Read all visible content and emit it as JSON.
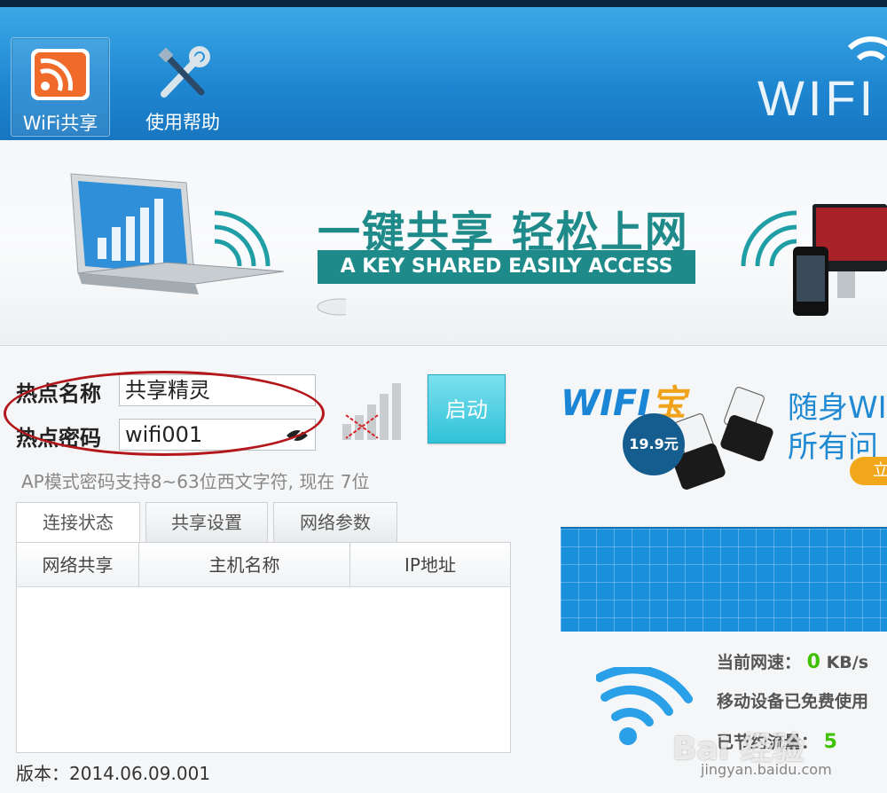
{
  "toolbar": {
    "items": [
      {
        "label": "WiFi共享",
        "icon": "rss-share-icon"
      },
      {
        "label": "使用帮助",
        "icon": "tools-icon"
      }
    ],
    "brand": "WIFI"
  },
  "banner": {
    "slogan_cn": "一键共享 轻松上网",
    "slogan_en": "A KEY SHARED EASILY ACCESS"
  },
  "hotspot": {
    "name_label": "热点名称",
    "name_value": "共享精灵",
    "password_label": "热点密码",
    "password_value": "wifi001",
    "start_label": "启动",
    "hint": "AP模式密码支持8~63位西文字符, 现在 7位"
  },
  "tabs": [
    {
      "label": "连接状态",
      "active": true
    },
    {
      "label": "共享设置",
      "active": false
    },
    {
      "label": "网络参数",
      "active": false
    }
  ],
  "table": {
    "columns": [
      "网络共享",
      "主机名称",
      "IP地址"
    ],
    "rows": []
  },
  "version": "版本：2014.06.09.001",
  "ad": {
    "brand": "WIFI宝",
    "line1": "随身WI",
    "line2": "所有问",
    "price": "19.9元",
    "button": "立"
  },
  "stats": {
    "speed_label": "当前网速：",
    "speed_value": "0",
    "speed_unit": "KB/s",
    "free_label": "移动设备已免费使用",
    "saved_label": "已节约流量：",
    "saved_value": "5"
  },
  "watermark": {
    "text": "Bai 经验",
    "url": "jingyan.baidu.com"
  },
  "colors": {
    "header": "#1e86d1",
    "teal": "#1f8a8a",
    "start": "#30c2d9",
    "accent": "#b3161b",
    "speed": "#3ec100"
  }
}
